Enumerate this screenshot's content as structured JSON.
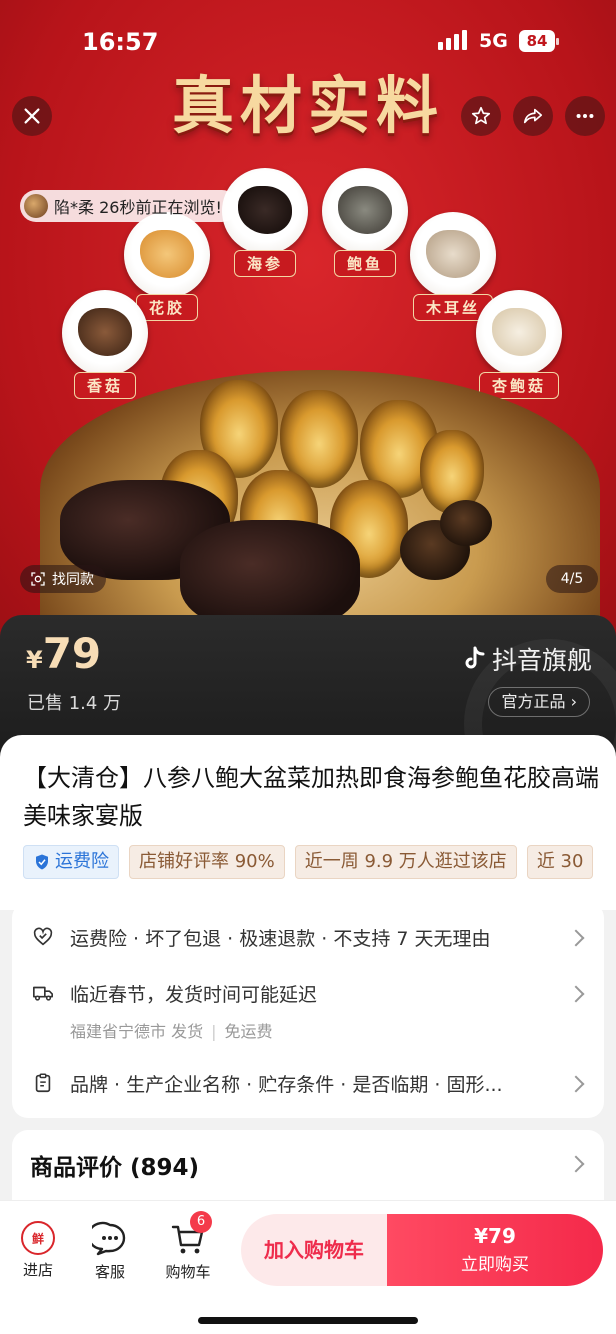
{
  "status_bar": {
    "time": "16:57",
    "network": "5G",
    "battery": "84"
  },
  "hero": {
    "headline": "真材实料",
    "browse_tip": "陷*柔 26秒前正在浏览!",
    "ingredients": [
      "海参",
      "鲍鱼",
      "花胶",
      "木耳丝",
      "香菇",
      "杏鲍菇"
    ],
    "find_same_label": "找同款",
    "pager": "4/5"
  },
  "price": {
    "currency": "¥",
    "amount": "79",
    "sold": "已售 1.4 万",
    "brand": "抖音旗舰",
    "official_label": "官方正品"
  },
  "product": {
    "title": "【大清仓】八参八鲍大盆菜加热即食海参鲍鱼花胶高端美味家宴版",
    "chips": [
      "运费险",
      "店铺好评率 90%",
      "近一周 9.9 万人逛过该店",
      "近 30"
    ]
  },
  "service": {
    "guarantee": "运费险 · 坏了包退 · 极速退款 · 不支持 7 天无理由",
    "shipping": "临近春节，发货时间可能延迟",
    "shipping_from": "福建省宁德市 发货",
    "shipping_fee": "免运费",
    "params": "品牌 · 生产企业名称 · 贮存条件 · 是否临期 · 固形..."
  },
  "reviews": {
    "title": "商品评价 (894)"
  },
  "bottom_bar": {
    "store_label": "进店",
    "service_label": "客服",
    "cart_label": "购物车",
    "cart_count": "6",
    "add_cart": "加入购物车",
    "buy_price": "¥79",
    "buy_now": "立即购买"
  },
  "colors": {
    "accent": "#f4294a",
    "hero_red": "#b8141a",
    "gold": "#f7ddb6"
  }
}
